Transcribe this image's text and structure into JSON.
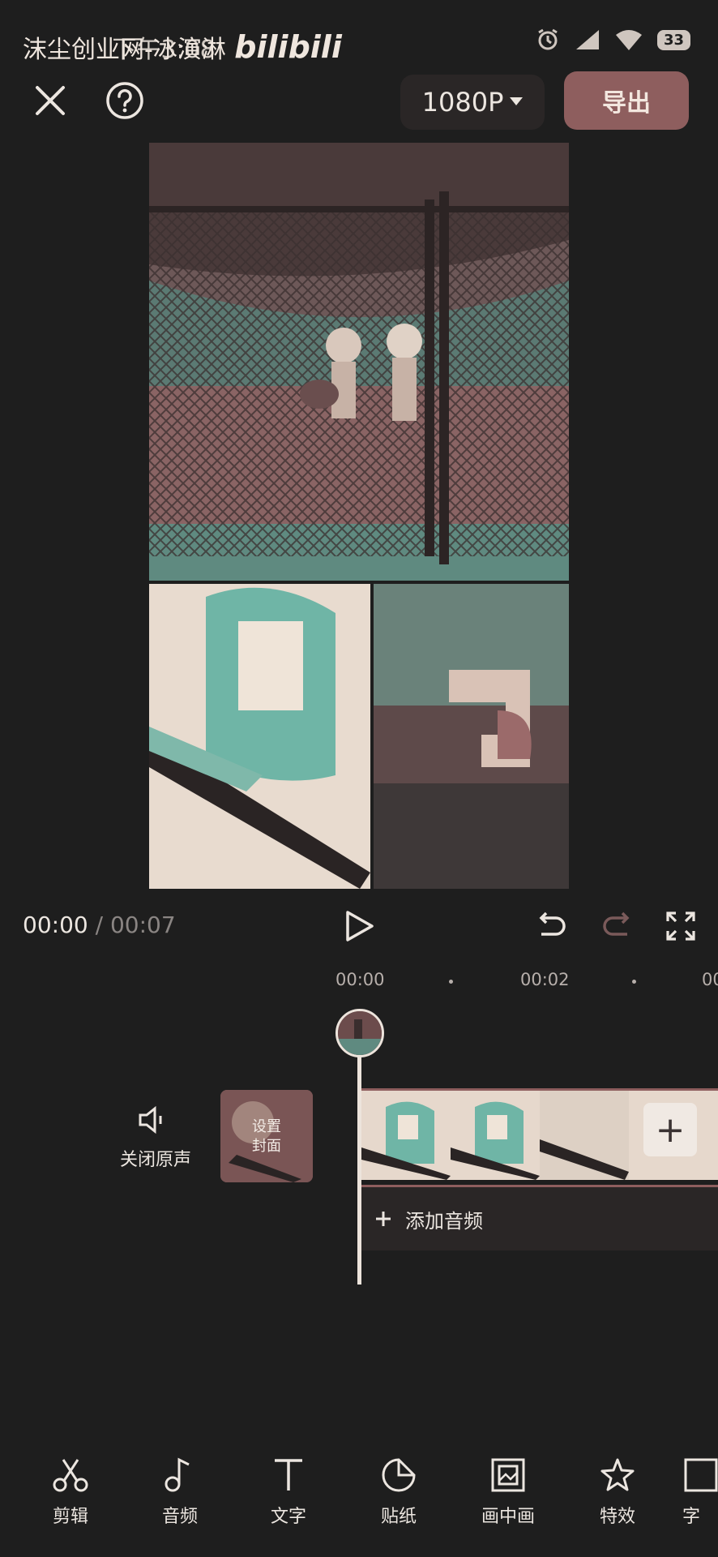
{
  "status_bar": {
    "overlay_text": "沫尘创业网-冰演淋",
    "time": "下午3:08",
    "brand": "bilibili",
    "battery": "33"
  },
  "top_bar": {
    "resolution": "1080P",
    "export_label": "导出"
  },
  "playback": {
    "current_time": "00:00",
    "separator": "/",
    "total_time": "00:07"
  },
  "ruler": {
    "ticks": [
      "00:00",
      "00:02",
      "00:0"
    ]
  },
  "tracks": {
    "mute_label": "关闭原声",
    "cover_label": "设置\n封面",
    "cover_label_line1": "设置",
    "cover_label_line2": "封面",
    "add_audio_label": "添加音频"
  },
  "toolbar": {
    "items": [
      {
        "label": "剪辑",
        "icon": "scissors-icon"
      },
      {
        "label": "音频",
        "icon": "music-note-icon"
      },
      {
        "label": "文字",
        "icon": "text-icon"
      },
      {
        "label": "贴纸",
        "icon": "sticker-icon"
      },
      {
        "label": "画中画",
        "icon": "picture-in-picture-icon"
      },
      {
        "label": "特效",
        "icon": "star-effect-icon"
      },
      {
        "label": "字",
        "icon": "caption-icon"
      }
    ]
  },
  "colors": {
    "background": "#1e1e1e",
    "accent": "#8e5e5e",
    "teal": "#6fb5a6",
    "cream": "#efe4d8"
  }
}
